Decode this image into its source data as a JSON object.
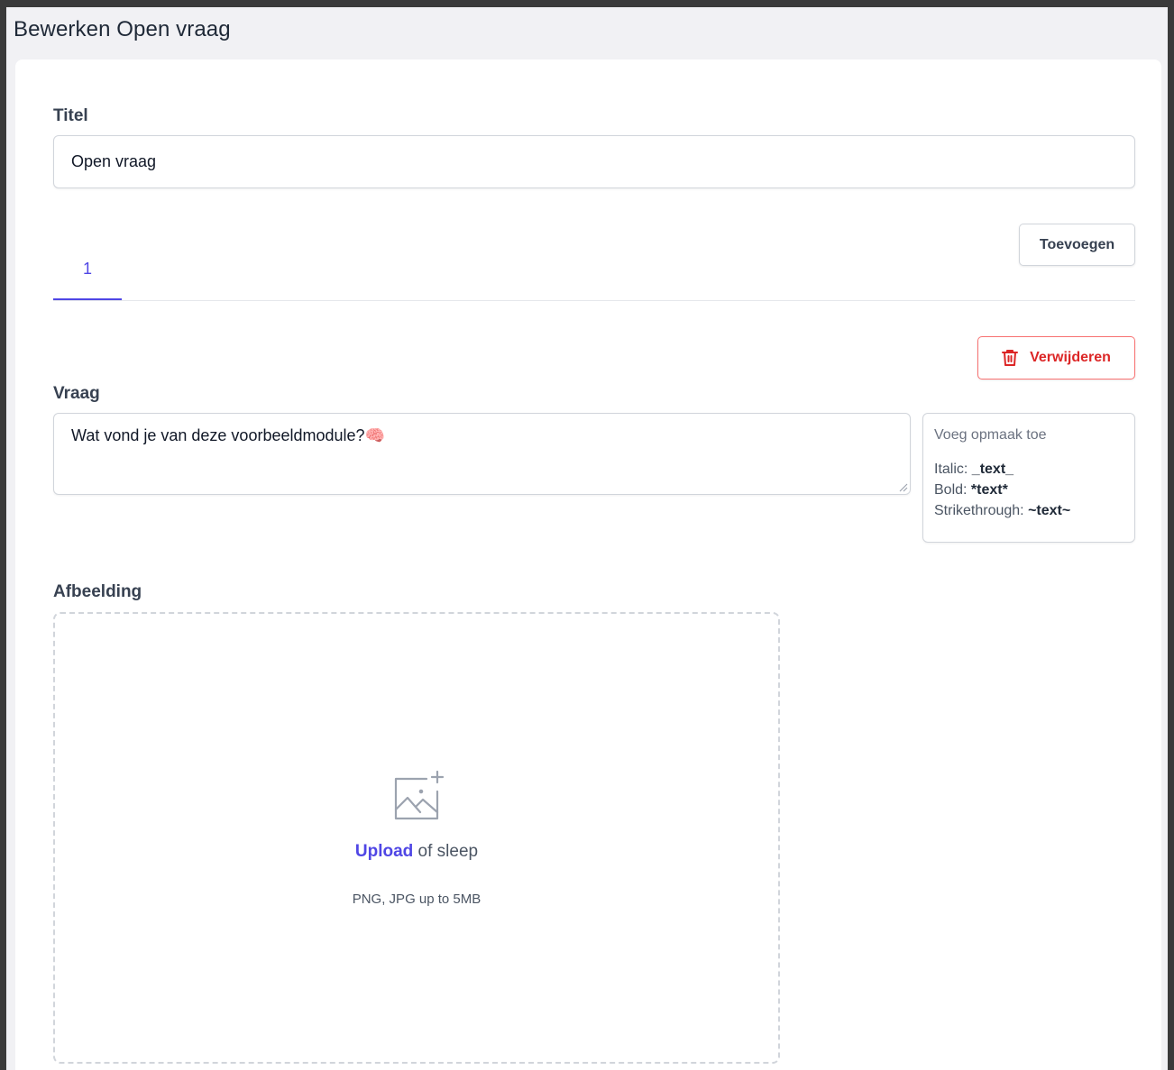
{
  "page": {
    "title": "Bewerken Open vraag"
  },
  "titel": {
    "label": "Titel",
    "value": "Open vraag"
  },
  "tabs": {
    "items": [
      {
        "label": "1"
      }
    ],
    "add_label": "Toevoegen"
  },
  "question": {
    "delete_label": "Verwijderen",
    "label": "Vraag",
    "value": "Wat vond je van deze voorbeeldmodule?🧠"
  },
  "formatting": {
    "title": "Voeg opmaak toe",
    "italic_label": "Italic:",
    "italic_syntax": "_text_",
    "bold_label": "Bold:",
    "bold_syntax": "*text*",
    "strike_label": "Strikethrough:",
    "strike_syntax": "~text~"
  },
  "image": {
    "label": "Afbeelding",
    "upload_link": "Upload",
    "upload_suffix": " of sleep",
    "hint": "PNG, JPG up to 5MB"
  },
  "colors": {
    "accent": "#4f46e5",
    "danger": "#dc2626",
    "background": "#f1f1f4",
    "border": "#d1d5db"
  }
}
